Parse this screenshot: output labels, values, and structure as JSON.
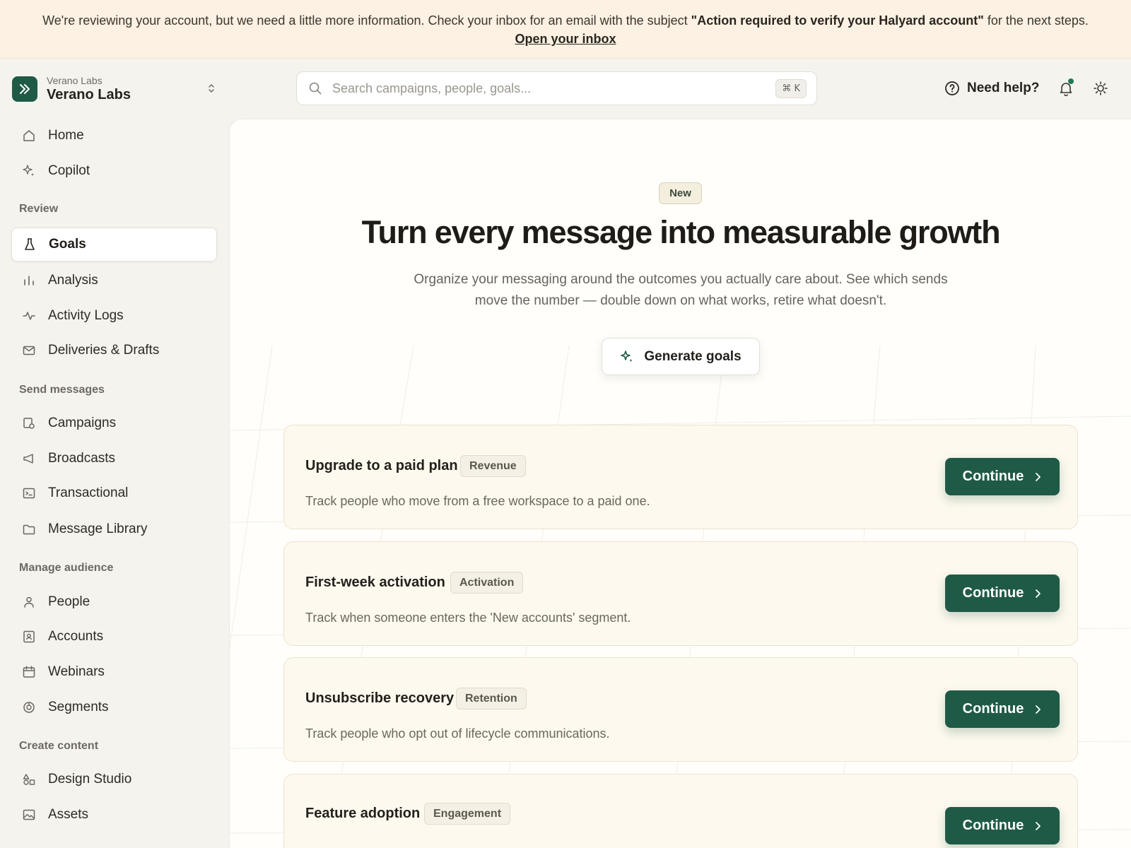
{
  "banner": {
    "text_before": "We're reviewing your account, but we need a little more information. Check your inbox for an email with the subject ",
    "subject": "\"Action required to verify your Halyard account\"",
    "text_after": " for the next steps. ",
    "link": "Open your inbox"
  },
  "org": {
    "subtitle": "Verano Labs",
    "name": "Verano Labs"
  },
  "sidebar": {
    "top_items": [
      {
        "label": "Home",
        "icon": "home-icon"
      },
      {
        "label": "Copilot",
        "icon": "sparkle-icon"
      }
    ],
    "sections": [
      {
        "label": "Review",
        "items": [
          {
            "label": "Goals",
            "icon": "flask-icon",
            "active": true
          },
          {
            "label": "Analysis",
            "icon": "bar-chart-icon"
          },
          {
            "label": "Activity Logs",
            "icon": "pulse-icon"
          },
          {
            "label": "Deliveries & Drafts",
            "icon": "mail-icon"
          }
        ]
      },
      {
        "label": "Send messages",
        "items": [
          {
            "label": "Campaigns",
            "icon": "campaign-icon"
          },
          {
            "label": "Broadcasts",
            "icon": "megaphone-icon"
          },
          {
            "label": "Transactional",
            "icon": "terminal-icon"
          },
          {
            "label": "Message Library",
            "icon": "folder-icon"
          }
        ]
      },
      {
        "label": "Manage audience",
        "items": [
          {
            "label": "People",
            "icon": "person-icon"
          },
          {
            "label": "Accounts",
            "icon": "contact-card-icon"
          },
          {
            "label": "Webinars",
            "icon": "calendar-icon"
          },
          {
            "label": "Segments",
            "icon": "pie-icon"
          }
        ]
      },
      {
        "label": "Create content",
        "items": [
          {
            "label": "Design Studio",
            "icon": "shapes-icon"
          },
          {
            "label": "Assets",
            "icon": "image-icon"
          }
        ]
      }
    ]
  },
  "topbar": {
    "search_placeholder": "Search campaigns, people, goals...",
    "shortcut": "⌘ K",
    "help_label": "Need help?"
  },
  "hero": {
    "badge": "New",
    "title": "Turn every message into measurable growth",
    "subtitle": "Organize your messaging around the outcomes you actually care about. See which sends move the number — double down on what works, retire what doesn't.",
    "button_label": "Generate goals"
  },
  "goals": [
    {
      "title": "Upgrade to a paid plan",
      "tag": "Revenue",
      "description": "Track people who move from a free workspace to a paid one.",
      "button": "Continue"
    },
    {
      "title": "First-week activation",
      "tag": "Activation",
      "description": "Track when someone enters the 'New accounts' segment.",
      "button": "Continue"
    },
    {
      "title": "Unsubscribe recovery",
      "tag": "Retention",
      "description": "Track people who opt out of lifecycle communications.",
      "button": "Continue"
    },
    {
      "title": "Feature adoption",
      "tag": "Engagement",
      "description": "",
      "button": "Continue"
    }
  ],
  "colors": {
    "accent": "#1f5a47",
    "banner_bg": "#fcf1e2",
    "card_bg": "#fdf9ee",
    "notification_dot": "#1f7a55"
  }
}
